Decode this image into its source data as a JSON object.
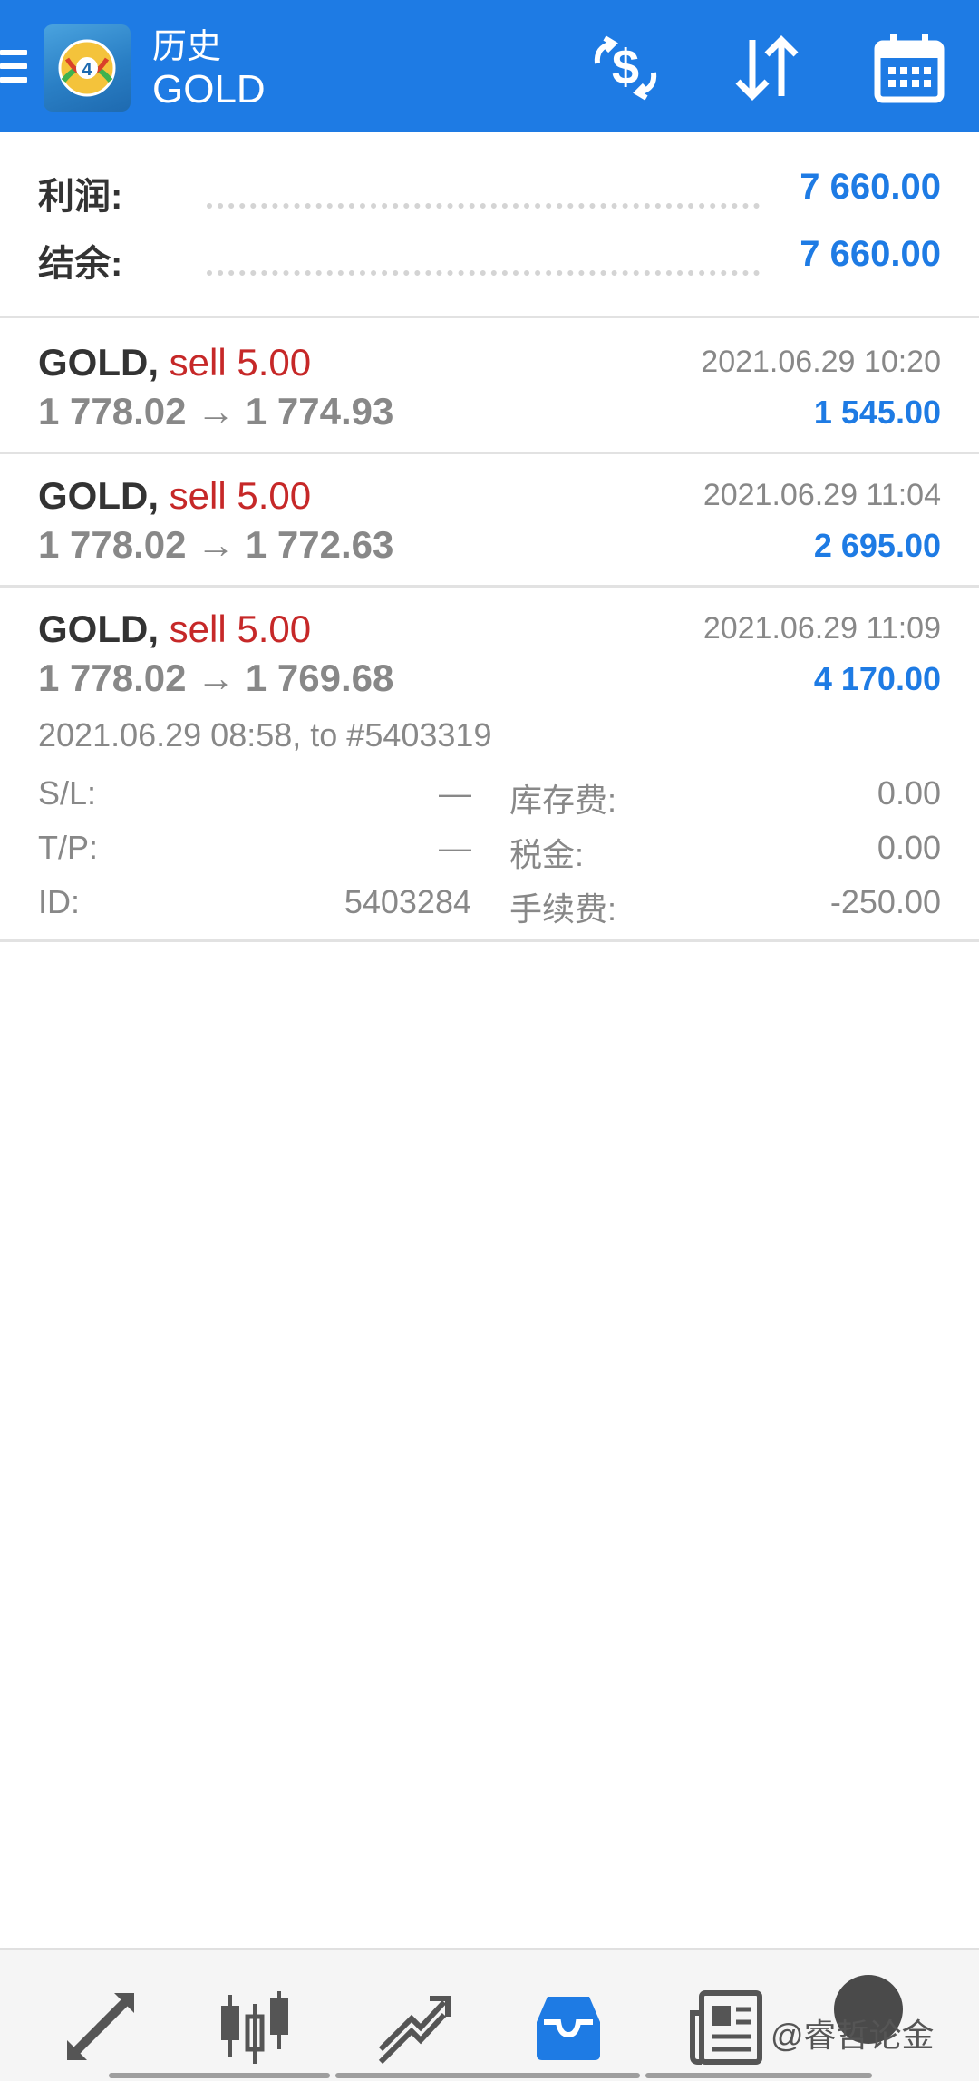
{
  "header": {
    "subtitle": "历史",
    "title": "GOLD",
    "icons": {
      "menu": "menu-icon",
      "logo": "metatrader-4-logo",
      "currency": "currency-exchange-icon",
      "sort": "sort-icon",
      "calendar": "calendar-icon"
    },
    "colors": {
      "bar": "#1e7be4"
    }
  },
  "summary": {
    "profit_label": "利润:",
    "profit_value": "7 660.00",
    "balance_label": "结余:",
    "balance_value": "7 660.00"
  },
  "trades": [
    {
      "symbol": "GOLD,",
      "side": "sell 5.00",
      "open": "1 778.02",
      "close": "1 774.93",
      "arrow": "→",
      "time": "2021.06.29 10:20",
      "profit": "1 545.00"
    },
    {
      "symbol": "GOLD,",
      "side": "sell 5.00",
      "open": "1 778.02",
      "close": "1 772.63",
      "arrow": "→",
      "time": "2021.06.29 11:04",
      "profit": "2 695.00"
    },
    {
      "symbol": "GOLD,",
      "side": "sell 5.00",
      "open": "1 778.02",
      "close": "1 769.68",
      "arrow": "→",
      "time": "2021.06.29 11:09",
      "profit": "4 170.00"
    }
  ],
  "details": {
    "open_info": "2021.06.29 08:58, to #5403319",
    "sl_label": "S/L:",
    "sl_value": "—",
    "tp_label": "T/P:",
    "tp_value": "—",
    "id_label": "ID:",
    "id_value": "5403284",
    "swap_label": "库存费:",
    "swap_value": "0.00",
    "tax_label": "税金:",
    "tax_value": "0.00",
    "commission_label": "手续费:",
    "commission_value": "-250.00"
  },
  "bottom_nav": {
    "items": [
      "quotes-icon",
      "chart-candles-icon",
      "trade-icon",
      "history-inbox-icon",
      "news-icon"
    ],
    "active": "history-inbox-icon",
    "watermark": "@睿哲论金"
  }
}
